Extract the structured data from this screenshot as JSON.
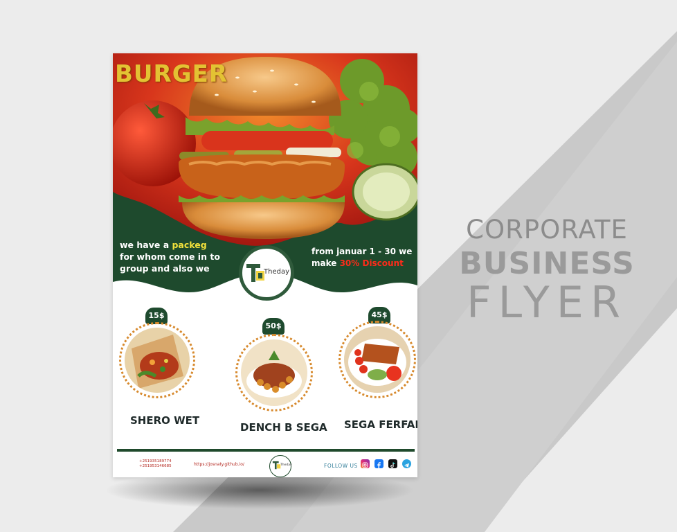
{
  "promo": {
    "line1": "CORPORATE",
    "line2": "BUSINESS",
    "line3": "FLYER"
  },
  "flyer": {
    "title": "BURGER",
    "left_text": {
      "pre": "we have a ",
      "highlight": "packeg",
      "post": " for whom come in to group and also we"
    },
    "right_text": {
      "pre": "from  januar 1 - 30 we make ",
      "discount": "30% Discount"
    },
    "logo_text": "Theday",
    "items": [
      {
        "price": "15$",
        "name": "SHERO WET"
      },
      {
        "price": "50$",
        "name": "DENCH B SEGA"
      },
      {
        "price": "45$",
        "name": "SEGA  FERFAR"
      }
    ],
    "footer": {
      "phone1": "+251935189774",
      "phone2": "+251953146685",
      "url": "https://josnaty.github.io/",
      "logo_text": "Theday",
      "follow": "FOLLOW US"
    }
  },
  "colors": {
    "dark_green": "#1f4a2c",
    "title_yellow": "#e3c233",
    "discount_red": "#ff2b1a",
    "background_gray": "#e9e9e9"
  },
  "icons": [
    "instagram-icon",
    "facebook-icon",
    "tiktok-icon",
    "telegram-icon"
  ]
}
